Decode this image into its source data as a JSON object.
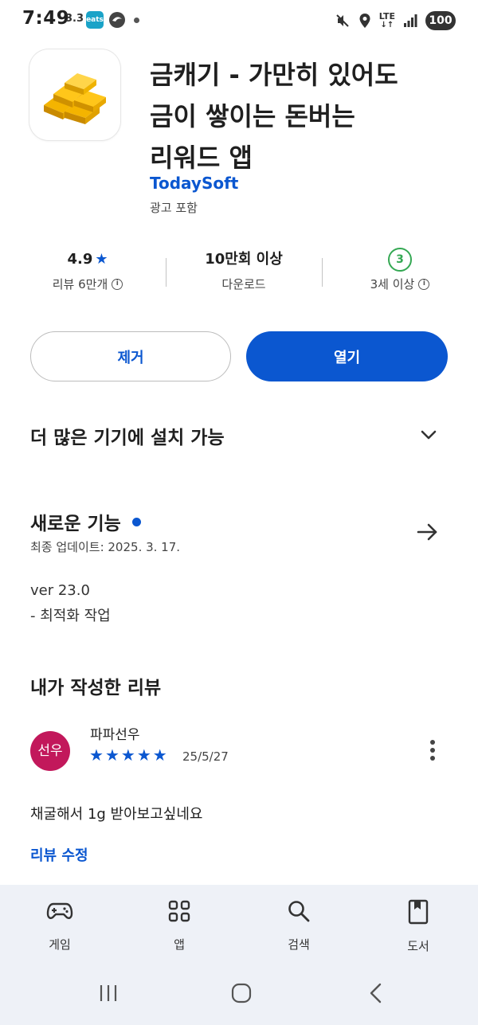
{
  "status_bar": {
    "time": "7:49",
    "temp": "3.3",
    "eats_label": "eats",
    "network": "LTE",
    "battery": "100"
  },
  "app": {
    "title_line1": "금캐기 - 가만히 있어도",
    "title_line2": "금이 쌓이는 돈버는",
    "title_line3": "리워드 앱",
    "developer": "TodaySoft",
    "ads_label": "광고 포함"
  },
  "stats": {
    "rating": "4.9",
    "reviews_label": "리뷰 6만개",
    "downloads": "10만회 이상",
    "downloads_label": "다운로드",
    "age_badge": "3",
    "age_label": "3세 이상"
  },
  "actions": {
    "remove_label": "제거",
    "open_label": "열기"
  },
  "more_devices": {
    "label": "더 많은 기기에 설치 가능"
  },
  "whats_new": {
    "title": "새로운 기능",
    "updated": "최종 업데이트: 2025. 3. 17.",
    "version": "ver 23.0",
    "note": "- 최적화 작업"
  },
  "my_review": {
    "title": "내가 작성한 리뷰",
    "avatar_text": "선우",
    "reviewer": "파파선우",
    "stars": 5,
    "date": "25/5/27",
    "text": "채굴해서 1g 받아보고싶네요",
    "edit_label": "리뷰 수정"
  },
  "bottom_nav": {
    "items": [
      {
        "label": "게임",
        "icon": "gamepad-icon"
      },
      {
        "label": "앱",
        "icon": "apps-grid-icon"
      },
      {
        "label": "검색",
        "icon": "search-icon"
      },
      {
        "label": "도서",
        "icon": "book-icon"
      }
    ]
  },
  "colors": {
    "accent": "#0b57d0",
    "avatar": "#c2185b",
    "age_green": "#34a853",
    "nav_bg": "#eef1f7"
  }
}
